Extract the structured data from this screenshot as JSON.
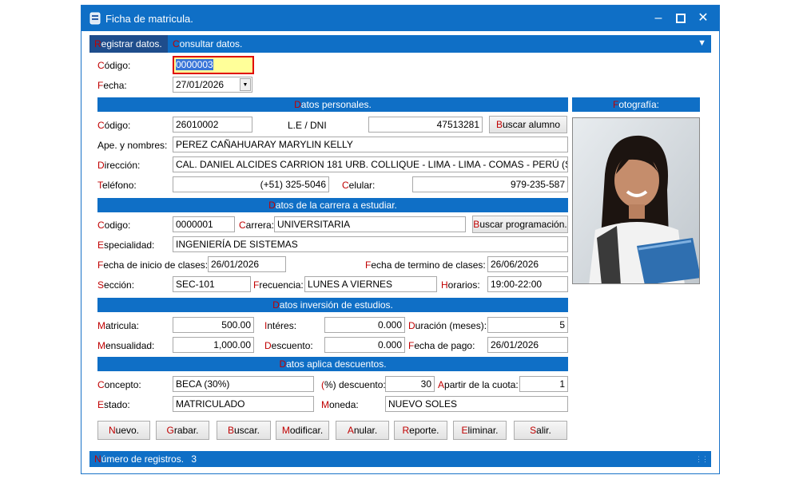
{
  "window": {
    "title": "Ficha de matricula."
  },
  "tabs": [
    {
      "hotkey": "R",
      "rest": "egistrar datos."
    },
    {
      "hotkey": "C",
      "rest": "onsultar  datos."
    }
  ],
  "top": {
    "codigo_hk": "C",
    "codigo_label": "ódigo:",
    "codigo_value": "0000003",
    "fecha_hk": "F",
    "fecha_label": "echa:",
    "fecha_value": "27/01/2026"
  },
  "personal": {
    "header_hk": "D",
    "header_rest": "atos personales.",
    "codigo_hk": "C",
    "codigo_label": "ódigo:",
    "codigo_value": "26010002",
    "dni_label": "L.E / DNI",
    "dni_value": "47513281",
    "buscar_hk": "B",
    "buscar_rest": "uscar alumno",
    "nombres_label": "Ape. y nombres:",
    "nombres_value": "PEREZ CAÑAHUARAY MARYLIN KELLY",
    "direccion_hk": "D",
    "direccion_label": "irección:",
    "direccion_value": "CAL. DANIEL ALCIDES CARRION 181 URB. COLLIQUE - LIMA - LIMA - COMAS - PERÚ (SUDAMÉRI",
    "telefono_hk": "T",
    "telefono_label": "eléfono:",
    "telefono_value": "(+51) 325-5046",
    "celular_hk": "C",
    "celular_label": "elular:",
    "celular_value": "979-235-587"
  },
  "photo": {
    "header_hk": "F",
    "header_rest": "otografía:"
  },
  "carrera": {
    "header_hk": "D",
    "header_rest": "atos de la carrera a estudiar.",
    "codigo_hk": "C",
    "codigo_label": "odigo:",
    "codigo_value": "0000001",
    "carrera_hk": "C",
    "carrera_label": "arrera:",
    "carrera_value": "UNIVERSITARIA",
    "buscar_hk": "B",
    "buscar_rest": "uscar programación.",
    "especialidad_hk": "E",
    "especialidad_label": "specialidad:",
    "especialidad_value": "INGENIERÍA DE SISTEMAS",
    "inicio_hk": "F",
    "inicio_label": "echa de inicio de clases:",
    "inicio_value": "26/01/2026",
    "termino_hk": "F",
    "termino_label": "echa de termino de clases:",
    "termino_value": "26/06/2026",
    "seccion_hk": "S",
    "seccion_label": "ección:",
    "seccion_value": "SEC-101",
    "frecuencia_hk": "F",
    "frecuencia_label": "recuencia:",
    "frecuencia_value": "LUNES A VIERNES",
    "horarios_hk": "H",
    "horarios_label": "orarios:",
    "horarios_value": "19:00-22:00"
  },
  "inversion": {
    "header_hk": "D",
    "header_rest": "atos inversión de estudios.",
    "matricula_hk": "M",
    "matricula_label": "atricula:",
    "matricula_value": "500.00",
    "interes_hk": "I",
    "interes_label": "ntéres:",
    "interes_value": "0.000",
    "duracion_hk": "D",
    "duracion_label": "uración (meses):",
    "duracion_value": "5",
    "mensualidad_hk": "M",
    "mensualidad_label": "ensualidad:",
    "mensualidad_value": "1,000.00",
    "descuento_hk": "D",
    "descuento_label": "escuento:",
    "descuento_value": "0.000",
    "pago_hk": "F",
    "pago_label": "echa de pago:",
    "pago_value": "26/01/2026"
  },
  "descuentos": {
    "header_hk": "D",
    "header_rest": "atos aplica descuentos.",
    "concepto_hk": "C",
    "concepto_label": "oncepto:",
    "concepto_value": "BECA (30%)",
    "pct_hk": "(",
    "pct_label": "%) descuento:",
    "pct_value": "30",
    "cuota_hk": "A",
    "cuota_label": "partir de la cuota:",
    "cuota_value": "1",
    "estado_hk": "E",
    "estado_label": "stado:",
    "estado_value": "MATRICULADO",
    "moneda_hk": "M",
    "moneda_label": "oneda:",
    "moneda_value": "NUEVO SOLES"
  },
  "buttons": [
    {
      "hk": "N",
      "rest": "uevo."
    },
    {
      "hk": "G",
      "rest": "rabar."
    },
    {
      "hk": "B",
      "rest": "uscar."
    },
    {
      "hk": "M",
      "rest": "odificar."
    },
    {
      "hk": "A",
      "rest": "nular."
    },
    {
      "hk": "R",
      "rest": "eporte."
    },
    {
      "hk": "E",
      "rest": "liminar."
    },
    {
      "hk": "S",
      "rest": "alir."
    }
  ],
  "status": {
    "hk": "N",
    "label": "úmero de registros.",
    "count": "3"
  },
  "colors": {
    "accent": "#0f6fc6",
    "hotkey": "#c00000",
    "highlight_field": "#ffff99",
    "selection_border": "#e00000"
  }
}
